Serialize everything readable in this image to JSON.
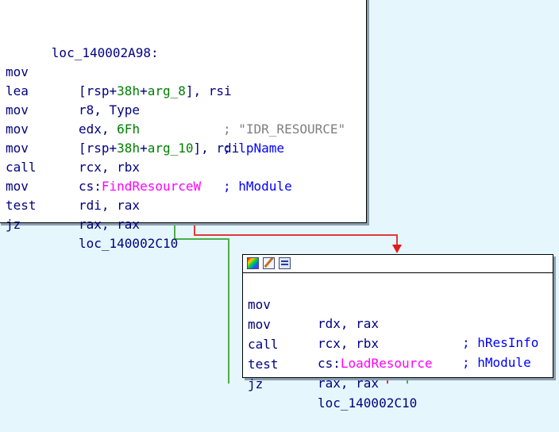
{
  "block_a": {
    "label": "loc_140002A98:",
    "lines": [
      {
        "mnemonic": "mov",
        "op1": "[rsp+",
        "op1_imm": "38h",
        "op1_mid": "+",
        "op1_var": "arg_8",
        "op1_end": "], rsi"
      },
      {
        "mnemonic": "lea",
        "operands": "r8, Type",
        "comment": "; \"IDR_RESOURCE\""
      },
      {
        "mnemonic": "mov",
        "operands_pre": "edx, ",
        "operands_imm": "6Fh",
        "comment": "; lpName"
      },
      {
        "mnemonic": "mov",
        "op1": "[rsp+",
        "op1_imm": "38h",
        "op1_mid": "+",
        "op1_var": "arg_10",
        "op1_end": "], rdi"
      },
      {
        "mnemonic": "mov",
        "operands": "rcx, rbx",
        "comment": "; hModule"
      },
      {
        "mnemonic": "call",
        "operands_pre": "cs:",
        "operands_ext": "FindResourceW"
      },
      {
        "mnemonic": "mov",
        "operands": "rdi, rax"
      },
      {
        "mnemonic": "test",
        "operands": "rax, rax"
      },
      {
        "mnemonic": "jz",
        "operands": "loc_140002C10"
      }
    ]
  },
  "block_b": {
    "lines": [
      {
        "mnemonic": "mov",
        "operands": "rdx, rax",
        "comment": "; hResInfo"
      },
      {
        "mnemonic": "mov",
        "operands": "rcx, rbx",
        "comment": "; hModule"
      },
      {
        "mnemonic": "call",
        "operands_pre": "cs:",
        "operands_ext": "LoadResource"
      },
      {
        "mnemonic": "test",
        "operands": "rax, rax"
      },
      {
        "mnemonic": "jz",
        "operands": "loc_140002C10"
      }
    ]
  },
  "toolbar_icons": [
    "palette-icon",
    "edit-icon",
    "graph-icon"
  ],
  "colors": {
    "background": "#e6f6fd",
    "instruction": "#000080",
    "immediate": "#008000",
    "external": "#ff00ff",
    "comment": "#0000ff",
    "edge_true": "#4cae4c",
    "edge_false": "#e03a3a"
  }
}
